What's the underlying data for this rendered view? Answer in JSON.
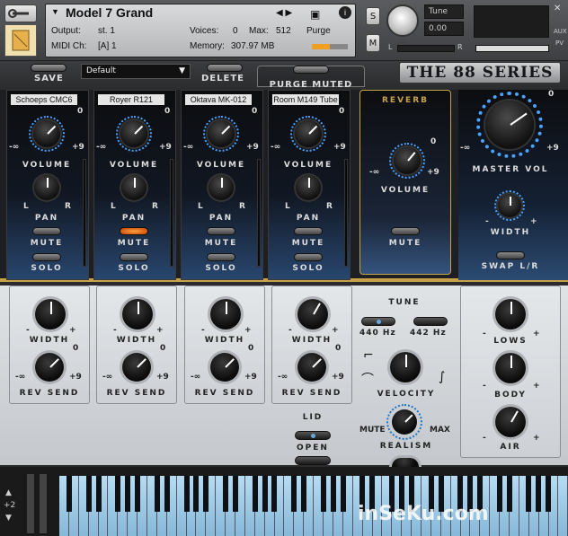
{
  "header": {
    "instrument": "Model 7 Grand",
    "output_label": "Output:",
    "output": "st. 1",
    "midi_label": "MIDI Ch:",
    "midi": "[A]  1",
    "voices_label": "Voices:",
    "voices": "0",
    "max_label": "Max:",
    "max": "512",
    "memory_label": "Memory:",
    "memory": "307.97 MB",
    "purge": "Purge",
    "tune_label": "Tune",
    "tune_value": "0.00",
    "s": "S",
    "m": "M",
    "l": "L",
    "r": "R",
    "aux": "AUX",
    "pv": "PV"
  },
  "toolbar": {
    "save": "SAVE",
    "preset": "Default",
    "delete": "DELETE",
    "purge_muted": "PURGE MUTED",
    "logo": "THE 88 SERIES"
  },
  "channels": [
    {
      "mic": "Schoeps CMC6",
      "volume": "VOLUME",
      "pan": "PAN",
      "mute": "MUTE",
      "solo": "SOLO",
      "mute_on": false
    },
    {
      "mic": "Royer R121",
      "volume": "VOLUME",
      "pan": "PAN",
      "mute": "MUTE",
      "solo": "SOLO",
      "mute_on": true
    },
    {
      "mic": "Oktava MK-012",
      "volume": "VOLUME",
      "pan": "PAN",
      "mute": "MUTE",
      "solo": "SOLO",
      "mute_on": false
    },
    {
      "mic": "Room M149 Tube",
      "volume": "VOLUME",
      "pan": "PAN",
      "mute": "MUTE",
      "solo": "SOLO",
      "mute_on": false
    }
  ],
  "scale": {
    "zero": "0",
    "neg_inf": "-∞",
    "plus9": "+9",
    "l": "L",
    "r": "R",
    "minus": "-",
    "plus": "+"
  },
  "reverb": {
    "title": "REVERB",
    "volume": "VOLUME",
    "mute": "MUTE"
  },
  "master": {
    "volume": "MASTER VOL",
    "width": "WIDTH",
    "swap": "SWAP L/R"
  },
  "lower": {
    "cells": [
      {
        "width": "WIDTH",
        "rev": "REV SEND"
      },
      {
        "width": "WIDTH",
        "rev": "REV SEND"
      },
      {
        "width": "WIDTH",
        "rev": "REV SEND"
      },
      {
        "width": "WIDTH",
        "rev": "REV SEND"
      }
    ],
    "tune": "TUNE",
    "hz440": "440 Hz",
    "hz442": "442 Hz",
    "velocity": "VELOCITY",
    "lid": "LID",
    "open": "OPEN",
    "mute": "MUTE",
    "max": "MAX",
    "realism": "REALISM",
    "lows": "LOWS",
    "body": "BODY",
    "air": "AIR"
  },
  "keyboard": {
    "octave": "+2"
  },
  "watermark": "inSeKu.com"
}
